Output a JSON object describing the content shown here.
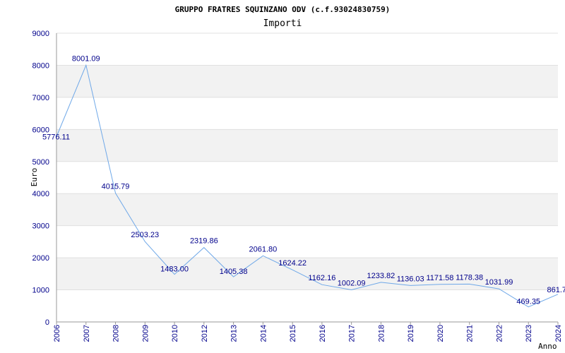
{
  "chart_data": {
    "type": "line",
    "title": "GRUPPO FRATRES SQUINZANO ODV (c.f.93024830759)",
    "subtitle": "Importi",
    "ylabel": "Euro",
    "xlabel": "Anno",
    "ylim": [
      0,
      9000
    ],
    "yticks": [
      0,
      1000,
      2000,
      3000,
      4000,
      5000,
      6000,
      7000,
      8000,
      9000
    ],
    "categories": [
      "2006",
      "2007",
      "2008",
      "2009",
      "2010",
      "2012",
      "2013",
      "2014",
      "2015",
      "2016",
      "2017",
      "2018",
      "2019",
      "2020",
      "2021",
      "2022",
      "2023",
      "2024"
    ],
    "values": [
      5776.11,
      8001.09,
      4015.79,
      2503.23,
      1483.0,
      2319.86,
      1405.38,
      2061.8,
      1624.22,
      1162.16,
      1002.09,
      1233.82,
      1136.03,
      1171.58,
      1178.38,
      1031.99,
      469.35,
      861.7
    ],
    "data_labels": [
      "5776.11",
      "8001.09",
      "4015.79",
      "2503.23",
      "1483.00",
      "2319.86",
      "1405.38",
      "2061.80",
      "1624.22",
      "1162.16",
      "1002.09",
      "1233.82",
      "1136.03",
      "1171.58",
      "1178.38",
      "1031.99",
      "469.35",
      "861.7"
    ],
    "grid": true,
    "legend": "none",
    "colors": {
      "line": "#6fa8e8",
      "band": "#f2f2f2",
      "tick_text": "#00008b",
      "grid": "#e0e0e0"
    }
  }
}
